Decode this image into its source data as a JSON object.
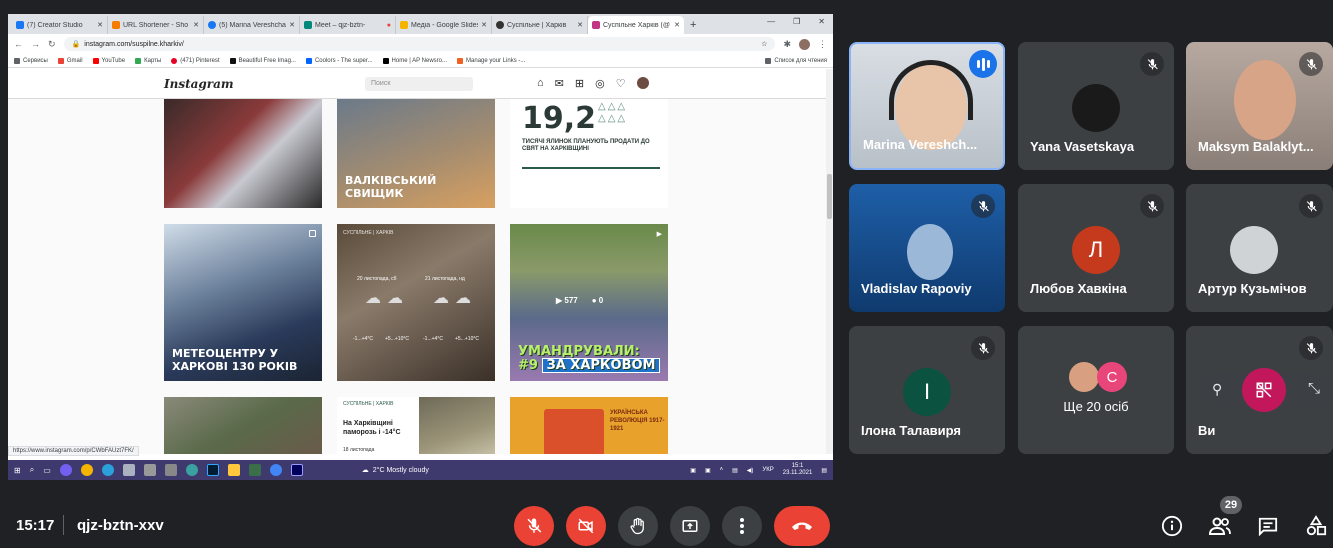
{
  "browser": {
    "tabs": [
      {
        "label": "(7) Creator Studio",
        "color": "#1877f2"
      },
      {
        "label": "URL Shortener - Sho",
        "color": "#f57c00"
      },
      {
        "label": "(5) Marina Vereshcha",
        "color": "#1877f2"
      },
      {
        "label": "Meet – qjz-bztn-",
        "color": "#00897b"
      },
      {
        "label": "Медіа - Google Slides",
        "color": "#f4b400"
      },
      {
        "label": "Суспільне | Харків",
        "color": "#333333"
      },
      {
        "label": "Суспільне Харків (@",
        "color": "#c13584",
        "active": true
      }
    ],
    "new_tab": "+",
    "url": "instagram.com/suspilne.kharkiv/",
    "bookmarks": [
      {
        "label": "Сервисы",
        "color": "#5f6368"
      },
      {
        "label": "Gmail",
        "color": "#ea4335"
      },
      {
        "label": "YouTube",
        "color": "#ff0000"
      },
      {
        "label": "Карты",
        "color": "#34a853"
      },
      {
        "label": "(471) Pinterest",
        "color": "#e60023"
      },
      {
        "label": "Beautiful Free Imag...",
        "color": "#111111"
      },
      {
        "label": "Coolors - The super...",
        "color": "#0066ff"
      },
      {
        "label": "Home | AP Newsro...",
        "color": "#000000"
      },
      {
        "label": "Manage your Links -...",
        "color": "#ee6123"
      }
    ],
    "reading_list": "Список для чтения",
    "status_url": "https://www.instagram.com/p/CWbFAUzt7FK/"
  },
  "instagram": {
    "logo": "Instagram",
    "search_placeholder": "Поиск",
    "posts": {
      "p2_title": "ВАЛКІВСЬКИЙ СВИЩИК",
      "p3_number": "19,2",
      "p3_text": "ТИСЯЧІ ЯЛИНОК ПЛАНУЮТЬ ПРОДАТИ ДО СВЯТ НА ХАРКІВЩИНІ",
      "p4_title": "МЕТЕОЦЕНТРУ У ХАРКОВІ 130 РОКІВ",
      "p5_brand": "СУСПІЛЬНЕ | ХАРКІВ",
      "p5_day1": "20 листопада, сб",
      "p5_day2": "21 листопада, нд",
      "p5_t1": "-1...+4°C",
      "p5_t2": "+5...+10°C",
      "p5_t3": "-1...+4°C",
      "p5_t4": "+5...+10°C",
      "p6_views": "577",
      "p6_comments": "0",
      "p6_title": "УМАНДРУВАЛИ:",
      "p6_num": "#9",
      "p6_sign": "ЗА ХАРКОВОМ",
      "p8_brand": "СУСПІЛЬНЕ | ХАРКІВ",
      "p8_title": "На Харківщині паморозь і -14°C",
      "p8_date": "18 листопада",
      "p9_text": "УКРАЇНСЬКА РЕВОЛЮЦІЯ 1917-1921"
    }
  },
  "taskbar": {
    "weather": "2°C  Mostly cloudy",
    "lang": "УКР",
    "time": "15:1",
    "date": "23.11.2021"
  },
  "participants": [
    {
      "name": "Marina Vereshch...",
      "speaking": true
    },
    {
      "name": "Yana Vasetskaya",
      "muted": true
    },
    {
      "name": "Maksym Balaklyt...",
      "muted": true
    },
    {
      "name": "Vladislav Rapoviy",
      "muted": true
    },
    {
      "name": "Любов Хавкіна",
      "initial": "Л",
      "avatar_color": "#c5391c",
      "muted": true
    },
    {
      "name": "Артур Кузьмічов",
      "muted": true
    },
    {
      "name": "Ілона Талавиря",
      "initial": "І",
      "avatar_color": "#0b5240",
      "muted": true
    },
    {
      "name": "Ще 20 осіб",
      "initial": "С",
      "avatar_color": "#e8457b"
    },
    {
      "name": "Ви",
      "muted": true
    }
  ],
  "meeting": {
    "time": "15:17",
    "code": "qjz-bztn-xxv",
    "people_count": "29"
  }
}
